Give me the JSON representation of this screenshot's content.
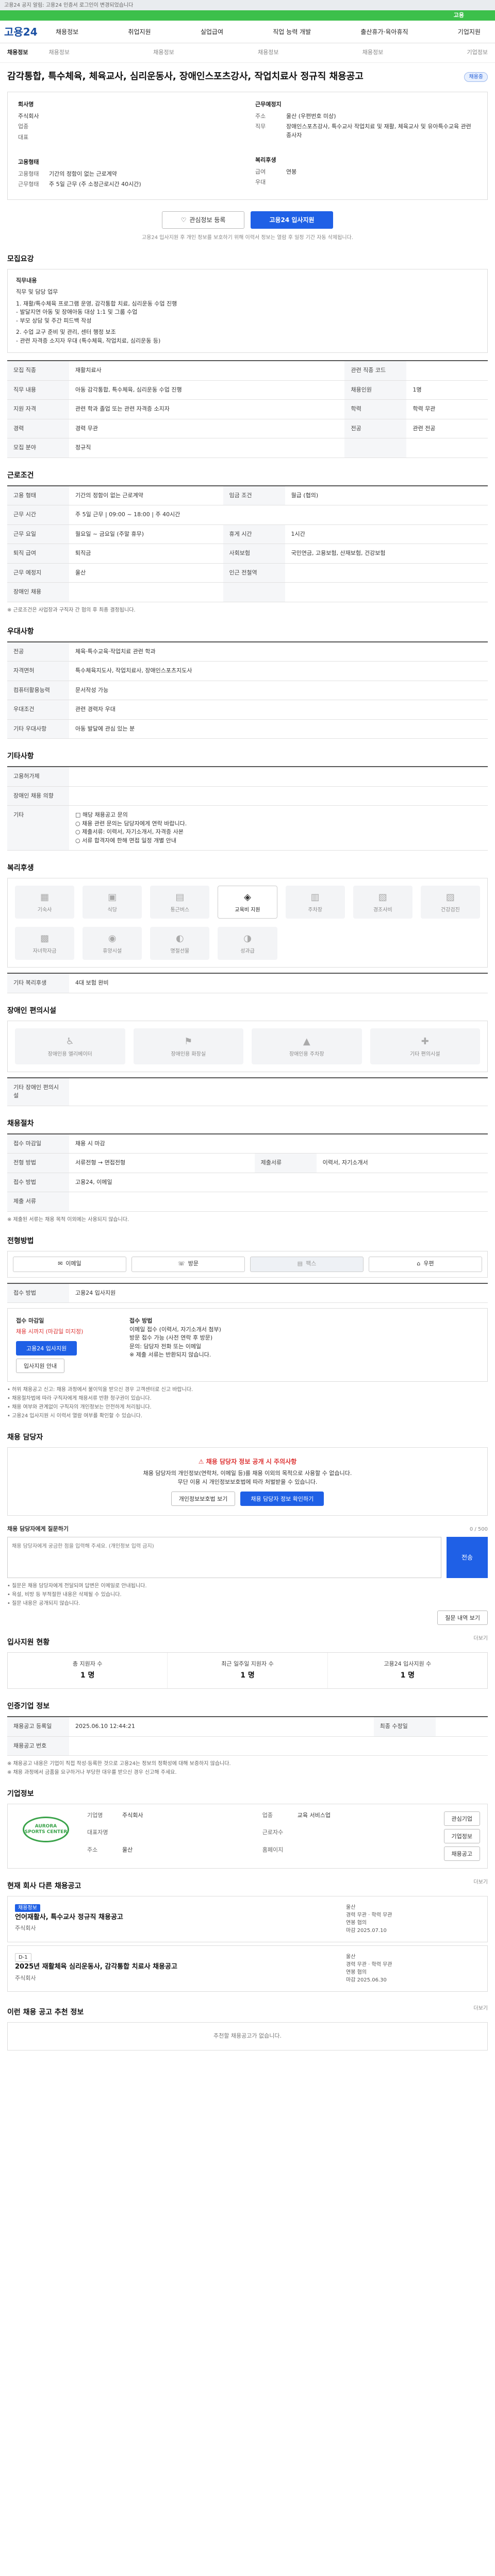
{
  "top_notice": "고용24 공지 알림: 고용24 인증서 로그인이 변경되었습니다",
  "green_bar": "고용",
  "logo": "고용24",
  "menu": [
    "채용정보",
    "취업지원",
    "실업급여",
    "직업 능력 개발",
    "출산휴가·육아휴직",
    "기업지원"
  ],
  "subnav": {
    "current": "채용정보",
    "items": [
      "채용정보",
      "채용정보",
      "채용정보",
      "채용정보",
      "기업정보"
    ]
  },
  "job": {
    "title": "감각통합, 특수체육, 체육교사, 심리운동사, 장애인스포츠강사, 작업치료사 정규직 채용공고",
    "badge": "채용중",
    "company_label": "회사명",
    "company_name": "주식회사",
    "rows_left": [
      {
        "k": "업종",
        "v": ""
      },
      {
        "k": "대표",
        "v": ""
      }
    ],
    "rows_right_label": "근무예정지",
    "rows_right": [
      {
        "k": "주소",
        "v": "울산 (우편번호 미상)"
      },
      {
        "k": "직무",
        "v": "장애인스포츠강사, 특수교사 작업치료 및 재활, 체육교사 및 유아특수교육 관련 종사자"
      }
    ],
    "status_label": "고용형태",
    "status_rows": [
      {
        "k": "고용형태",
        "v": "기간의 정함이 없는 근로계약"
      },
      {
        "k": "근무형태",
        "v": "주 5일 근무 (주 소정근로시간 40시간)"
      }
    ],
    "pay_label": "복리후생",
    "pay_rows": [
      {
        "k": "급여",
        "v": "연봉"
      },
      {
        "k": "우대",
        "v": ""
      }
    ]
  },
  "apply": {
    "scrap": "관심정보 등록",
    "apply": "고용24 입사지원",
    "note": "고용24 입사지원 후 개인 정보를 보호하기 위해 이력서 정보는 열람 후 일정 기간 자동 삭제됩니다."
  },
  "sections": {
    "recruit": "모집요강",
    "conditions": "근로조건",
    "benefits": "우대사항",
    "etc": "기타사항",
    "welfare": "복리후생",
    "disabled": "장애인 편의시설",
    "screening": "채용절차",
    "method": "전형방법",
    "qa": "채용 담당자",
    "stats": "입사지원 현황",
    "info": "인증기업 정보",
    "corp": "기업정보",
    "list": "현재 회사 다른 채용공고",
    "rec": "이런 채용 공고 추천 정보"
  },
  "recruit_box": {
    "sub": "직무내용",
    "lines": [
      "직무 및 담당 업무",
      "1. 재활/특수체육 프로그램 운영, 감각통합 치료, 심리운동 수업 진행",
      "  - 발달지연 아동 및 장애아동 대상 1:1 및 그룹 수업",
      "  - 부모 상담 및 주간 피드백 작성",
      "2. 수업 교구 준비 및 관리, 센터 행정 보조",
      "  - 관련 자격증 소지자 우대 (특수체육, 작업치료, 심리운동 등)"
    ]
  },
  "recruit_table": [
    {
      "k": "모집 직종",
      "v": "재활치료사",
      "k2": "관련 직종 코드",
      "v2": ""
    },
    {
      "k": "직무 내용",
      "v": "아동 감각통합, 특수체육, 심리운동 수업 진행",
      "k2": "채용인원",
      "v2": "1명"
    },
    {
      "k": "지원 자격",
      "v": "관련 학과 졸업 또는 관련 자격증 소지자",
      "k2": "학력",
      "v2": "학력 무관"
    },
    {
      "k": "경력",
      "v": "경력 무관",
      "k2": "전공",
      "v2": "관련 전공"
    },
    {
      "k": "모집 분야",
      "v": "정규직",
      "k2": "",
      "v2": ""
    }
  ],
  "cond_table": [
    {
      "k": "고용 형태",
      "v": "기간의 정함이 없는 근로계약",
      "k2": "임금 조건",
      "v2": "월급 (협의)"
    },
    {
      "k": "근무 시간",
      "v": "주 5일 근무 | 09:00 ~ 18:00 | 주 40시간",
      "k2": "",
      "v2": ""
    },
    {
      "k": "근무 요일",
      "v": "월요일 ~ 금요일 (주말 휴무)",
      "k2": "휴게 시간",
      "v2": "1시간"
    },
    {
      "k": "퇴직 급여",
      "v": "퇴직금",
      "k2": "사회보험",
      "v2": "국민연금, 고용보험, 산재보험, 건강보험"
    },
    {
      "k": "근무 예정지",
      "v": "울산",
      "k2": "인근 전철역",
      "v2": ""
    },
    {
      "k": "장애인 채용",
      "v": "",
      "k2": "",
      "v2": ""
    }
  ],
  "cond_note": "※ 근로조건은 사업장과 구직자 간 협의 후 최종 결정됩니다.",
  "benefit_table": [
    {
      "k": "전공",
      "v": "체육·특수교육·작업치료 관련 학과"
    },
    {
      "k": "자격면허",
      "v": "특수체육지도사, 작업치료사, 장애인스포츠지도사"
    },
    {
      "k": "컴퓨터활용능력",
      "v": "문서작성 가능"
    },
    {
      "k": "우대조건",
      "v": "관련 경력자 우대"
    },
    {
      "k": "기타 우대사항",
      "v": "아동 발달에 관심 있는 분"
    }
  ],
  "etc_table": [
    {
      "k": "고용허가제",
      "v": ""
    },
    {
      "k": "장애인 채용 의향",
      "v": ""
    },
    {
      "k": "기타",
      "v": ""
    }
  ],
  "etc_list": [
    "□ 해당 채용공고 문의",
    "  ○ 채용 관련 문의는 담당자에게 연락 바랍니다.",
    "  ○ 제출서류: 이력서, 자기소개서, 자격증 사본",
    "  ○ 서류 합격자에 한해 면접 일정 개별 안내"
  ],
  "welfare_icons": [
    {
      "icon": "▦",
      "label": "기숙사",
      "active": false
    },
    {
      "icon": "▣",
      "label": "식당",
      "active": false
    },
    {
      "icon": "▤",
      "label": "통근버스",
      "active": false
    },
    {
      "icon": "◈",
      "label": "교육비 지원",
      "active": true
    },
    {
      "icon": "▥",
      "label": "주차장",
      "active": false
    },
    {
      "icon": "▧",
      "label": "경조사비",
      "active": false
    },
    {
      "icon": "▨",
      "label": "건강검진",
      "active": false
    },
    {
      "icon": "▩",
      "label": "자녀학자금",
      "active": false
    },
    {
      "icon": "◉",
      "label": "휴양시설",
      "active": false
    },
    {
      "icon": "◐",
      "label": "명절선물",
      "active": false
    },
    {
      "icon": "◑",
      "label": "성과급",
      "active": false
    }
  ],
  "welfare_etc_label": "기타 복리후생",
  "welfare_etc_value": "4대 보험 완비",
  "disabled_icons": [
    {
      "icon": "♿",
      "label": "장애인용 엘리베이터"
    },
    {
      "icon": "⚑",
      "label": "장애인용 화장실"
    },
    {
      "icon": "▲",
      "label": "장애인용 주차장"
    },
    {
      "icon": "✚",
      "label": "기타 편의시설"
    }
  ],
  "disabled_etc_label": "기타 장애인 편의시설",
  "screen_table": [
    {
      "k": "접수 마감일",
      "v": "채용 시 마감",
      "k2": "",
      "v2": ""
    },
    {
      "k": "전형 방법",
      "v": "서류전형 → 면접전형",
      "k2": "제출서류",
      "v2": "이력서, 자기소개서"
    },
    {
      "k": "접수 방법",
      "v": "고용24, 이메일",
      "k2": "",
      "v2": ""
    },
    {
      "k": "제출 서류",
      "v": "",
      "k2": "",
      "v2": ""
    }
  ],
  "screen_note": "※ 제출된 서류는 채용 목적 이외에는 사용되지 않습니다.",
  "method_tabs": [
    {
      "icon": "✉",
      "label": "이메일",
      "sel": false
    },
    {
      "icon": "☏",
      "label": "방문",
      "sel": false
    },
    {
      "icon": "▤",
      "label": "팩스",
      "sel": true
    },
    {
      "icon": "⌂",
      "label": "우편",
      "sel": false
    }
  ],
  "method_label": "접수 방법",
  "method_value": "고용24 입사지원",
  "steps": {
    "left_title": "접수 마감일",
    "left_value": "채용 시까지 (마감일 미지정)",
    "left_btn": "고용24 입사지원",
    "left_btn2": "입사지원 안내",
    "right_title": "접수 방법",
    "right_lines": [
      "이메일 접수 (이력서, 자기소개서 첨부)",
      "방문 접수 가능 (사전 연락 후 방문)",
      "문의: 담당자 전화 또는 이메일",
      "※ 제출 서류는 반환되지 않습니다."
    ]
  },
  "method_notes": [
    "• 허위 채용공고 신고: 채용 과정에서 불이익을 받으신 경우 고객센터로 신고 바랍니다.",
    "• 채용절차법에 따라 구직자에게 채용서류 반환 청구권이 있습니다.",
    "• 채용 여부와 관계없이 구직자의 개인정보는 안전하게 처리됩니다.",
    "• 고용24 입사지원 시 이력서 열람 여부를 확인할 수 있습니다."
  ],
  "alert": {
    "warn": "채용 담당자 정보 공개 시 주의사항",
    "line1": "채용 담당자의 개인정보(연락처, 이메일 등)를 채용 이외의 목적으로 사용할 수 없습니다.",
    "line2": "무단 이용 시 개인정보보호법에 따라 처벌받을 수 있습니다.",
    "btn1": "개인정보보호법 보기",
    "btn2": "채용 담당자 정보 확인하기"
  },
  "qa": {
    "label": "채용 담당자에게 질문하기",
    "count": "0 / 500",
    "placeholder": "채용 담당자에게 궁금한 점을 입력해 주세요. (개인정보 입력 금지)",
    "send": "전송",
    "notes": [
      "• 질문은 채용 담당자에게 전달되며 답변은 이메일로 안내됩니다.",
      "• 욕설, 비방 등 부적절한 내용은 삭제될 수 있습니다.",
      "• 질문 내용은 공개되지 않습니다."
    ],
    "btn": "질문 내역 보기"
  },
  "stats": [
    {
      "label": "총 지원자 수",
      "value": "1 명"
    },
    {
      "label": "최근 일주일 지원자 수",
      "value": "1 명"
    },
    {
      "label": "고용24 입사지원 수",
      "value": "1 명"
    }
  ],
  "info_table": [
    {
      "k": "채용공고 등록일",
      "v": "2025.06.10 12:44:21",
      "k2": "최종 수정일",
      "v2": ""
    },
    {
      "k": "채용공고 번호",
      "v": "",
      "k2": "",
      "v2": ""
    }
  ],
  "info_notes": [
    "※ 채용공고 내용은 기업이 직접 작성·등록한 것으로 고용24는 정보의 정확성에 대해 보증하지 않습니다.",
    "※ 채용 과정에서 금품을 요구하거나 부당한 대우를 받으신 경우 신고해 주세요."
  ],
  "corp": {
    "logo_text": "AURORA SPORTS CENTER",
    "rows": [
      {
        "k": "기업명",
        "v": "주식회사"
      },
      {
        "k": "업종",
        "v": "교육 서비스업"
      },
      {
        "k": "대표자명",
        "v": ""
      },
      {
        "k": "근로자수",
        "v": ""
      },
      {
        "k": "주소",
        "v": "울산"
      },
      {
        "k": "홈페이지",
        "v": ""
      }
    ],
    "btn1": "관심기업",
    "btn2": "기업정보",
    "btn3": "채용공고"
  },
  "list": [
    {
      "tag": "채용정보",
      "title": "언어재활사, 특수교사 정규직 채용공고",
      "meta": "주식회사",
      "right": [
        "울산",
        "경력 무관 · 학력 무관",
        "연봉 협의",
        "마감 2025.07.10"
      ]
    },
    {
      "tag": "D-1",
      "title": "2025년 재활체육 심리운동사, 감각통합 치료사 채용공고",
      "meta": "주식회사",
      "right": [
        "울산",
        "경력 무관 · 학력 무관",
        "연봉 협의",
        "마감 2025.06.30"
      ]
    }
  ],
  "list_more": "더보기",
  "rec_empty": "추천할 채용공고가 없습니다.",
  "colors": {
    "brand": "#1a4fa3",
    "primary": "#1f60e6",
    "green": "#3cc04b",
    "danger": "#dd3333"
  }
}
